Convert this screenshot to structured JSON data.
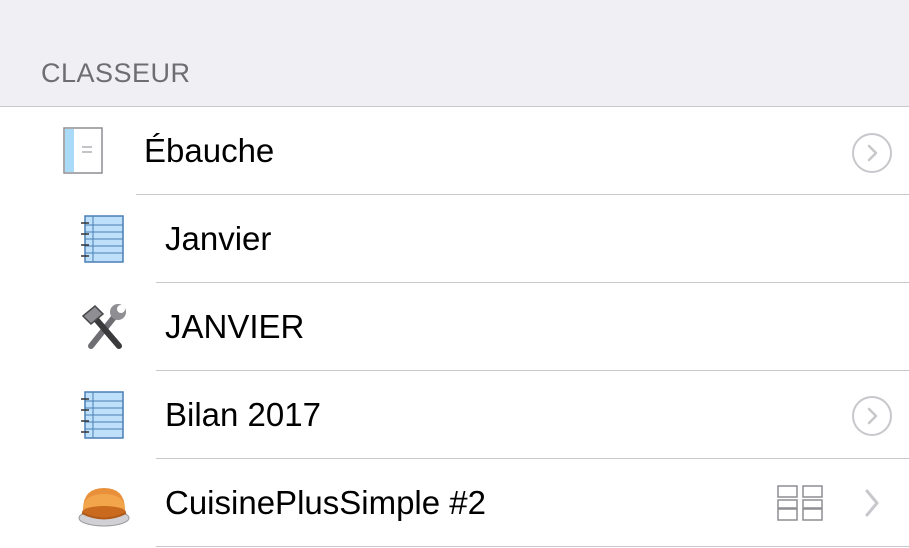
{
  "section": {
    "title": "CLASSEUR"
  },
  "rows": [
    {
      "label": "Ébauche",
      "icon": "draft-document-icon",
      "accessory": "detail-disclosure-button"
    },
    {
      "label": "Janvier",
      "icon": "notebook-icon",
      "accessory": "none"
    },
    {
      "label": "JANVIER",
      "icon": "hammer-wrench-icon",
      "accessory": "none"
    },
    {
      "label": "Bilan 2017",
      "icon": "notebook-icon",
      "accessory": "detail-disclosure-button"
    },
    {
      "label": "CuisinePlusSimple #2",
      "icon": "pie-icon",
      "accessory": "grid-icon-and-chevron"
    }
  ],
  "colors": {
    "header_bg": "#efeff4",
    "header_text": "#6d6d72",
    "separator": "#c8c7cc",
    "disclosure": "#c7c7cc",
    "notebook_fill": "#bfe0fb",
    "notebook_stroke": "#4a7fb5"
  }
}
